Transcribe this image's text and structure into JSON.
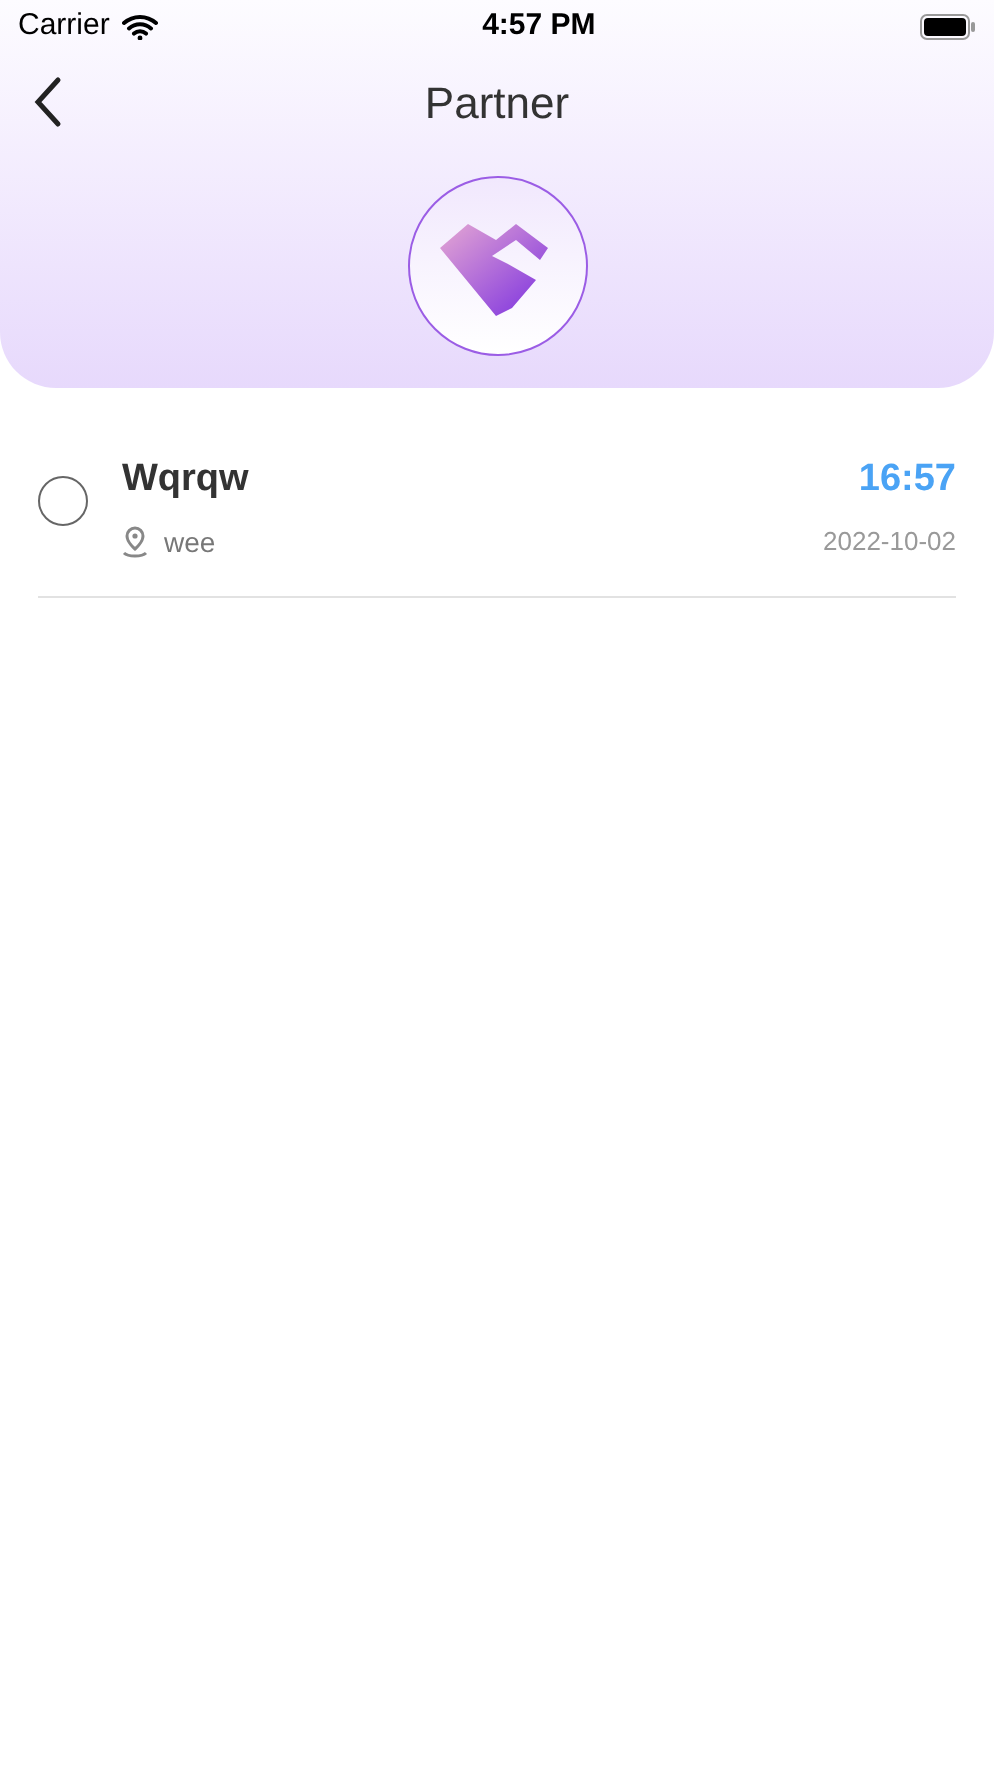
{
  "status_bar": {
    "carrier": "Carrier",
    "time": "4:57 PM"
  },
  "nav": {
    "title": "Partner"
  },
  "items": [
    {
      "name": "Wqrqw",
      "location": "wee",
      "time": "16:57",
      "date": "2022-10-02",
      "selected": false
    }
  ]
}
